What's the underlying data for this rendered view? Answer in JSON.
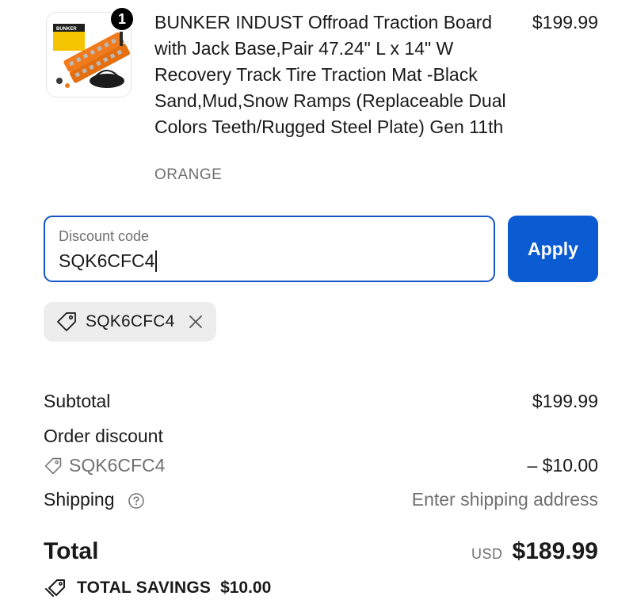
{
  "product": {
    "quantity": "1",
    "title": "BUNKER INDUST Offroad Traction Board with Jack Base,Pair 47.24\" L x 14\" W Recovery Track Tire Traction Mat -Black Sand,Mud,Snow Ramps (Replaceable Dual Colors Teeth/Rugged Steel Plate) Gen 11th",
    "variant": "ORANGE",
    "price": "$199.99",
    "image_brand_text": "BUNKER",
    "image_icon": "traction-board-product-image"
  },
  "discount": {
    "label": "Discount code",
    "value": "SQK6CFC4",
    "apply_label": "Apply",
    "applied_code": "SQK6CFC4"
  },
  "summary": {
    "subtotal_label": "Subtotal",
    "subtotal_value": "$199.99",
    "order_discount_label": "Order discount",
    "discount_code": "SQK6CFC4",
    "discount_value": "– $10.00",
    "shipping_label": "Shipping",
    "shipping_value": "Enter shipping address",
    "total_label": "Total",
    "currency": "USD",
    "total_value": "$189.99",
    "savings_label": "TOTAL SAVINGS",
    "savings_value": "$10.00"
  },
  "colors": {
    "accent": "#0b5bd3",
    "focus_border": "#1556c7",
    "muted_text": "#707070",
    "chip_bg": "#ededed",
    "product_orange": "#f07a1c"
  }
}
